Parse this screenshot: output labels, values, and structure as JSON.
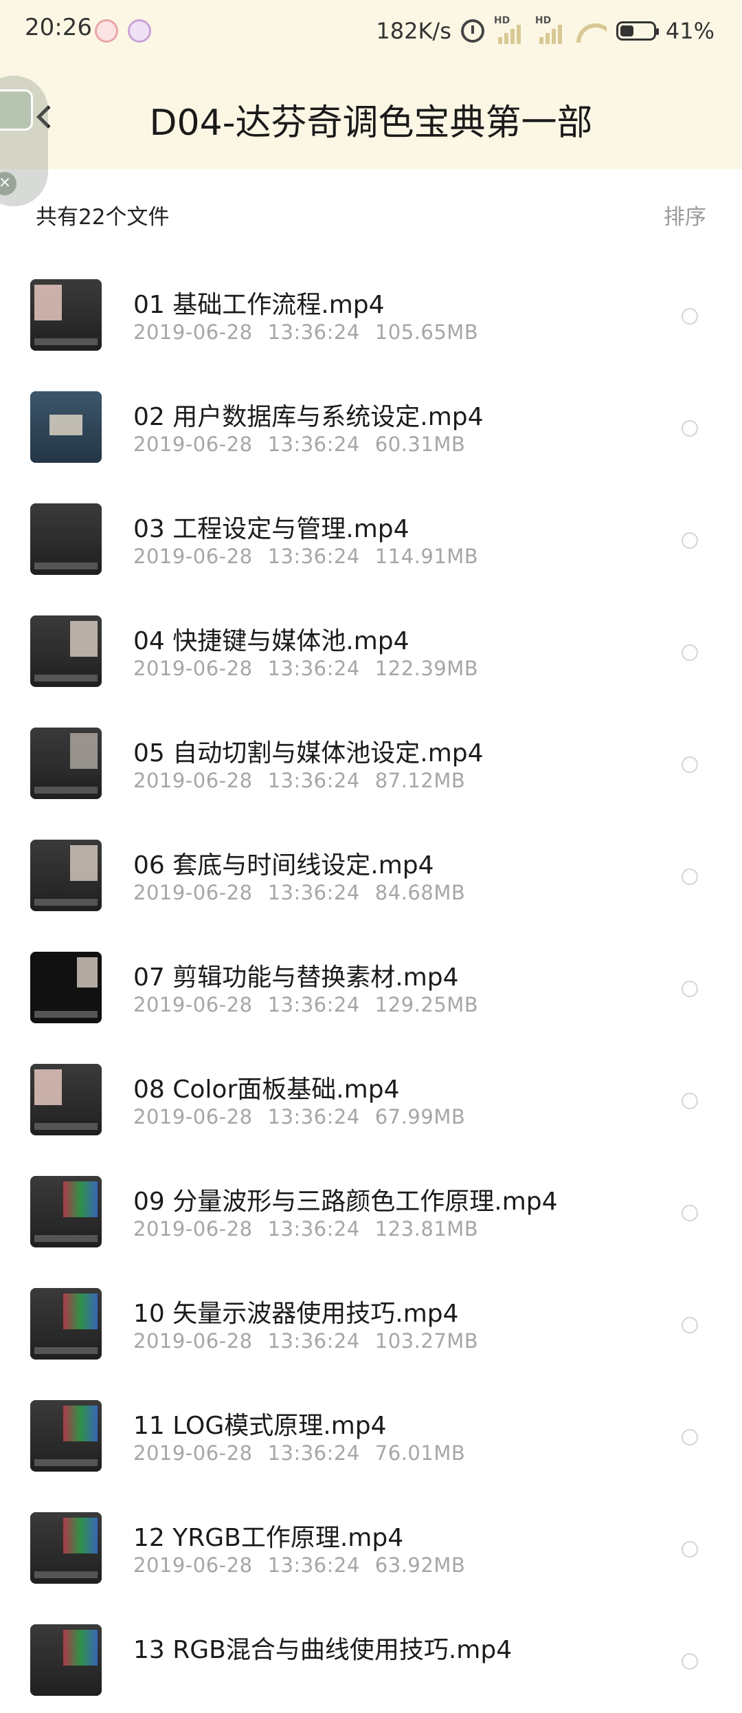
{
  "status_bar": {
    "time": "20:26",
    "net_speed": "182K/s",
    "signal1_label": "HD",
    "signal2_label": "HD",
    "battery": "41%"
  },
  "header": {
    "title": "D04-达芬奇调色宝典第一部"
  },
  "summary": {
    "count_text": "共有22个文件",
    "sort_label": "排序"
  },
  "files": [
    {
      "name": "01 基础工作流程.mp4",
      "date": "2019-06-28",
      "time": "13:36:24",
      "size": "105.65MB"
    },
    {
      "name": "02 用户数据库与系统设定.mp4",
      "date": "2019-06-28",
      "time": "13:36:24",
      "size": "60.31MB"
    },
    {
      "name": "03 工程设定与管理.mp4",
      "date": "2019-06-28",
      "time": "13:36:24",
      "size": "114.91MB"
    },
    {
      "name": "04 快捷键与媒体池.mp4",
      "date": "2019-06-28",
      "time": "13:36:24",
      "size": "122.39MB"
    },
    {
      "name": "05 自动切割与媒体池设定.mp4",
      "date": "2019-06-28",
      "time": "13:36:24",
      "size": "87.12MB"
    },
    {
      "name": "06 套底与时间线设定.mp4",
      "date": "2019-06-28",
      "time": "13:36:24",
      "size": "84.68MB"
    },
    {
      "name": "07 剪辑功能与替换素材.mp4",
      "date": "2019-06-28",
      "time": "13:36:24",
      "size": "129.25MB"
    },
    {
      "name": "08 Color面板基础.mp4",
      "date": "2019-06-28",
      "time": "13:36:24",
      "size": "67.99MB"
    },
    {
      "name": "09 分量波形与三路颜色工作原理.mp4",
      "date": "2019-06-28",
      "time": "13:36:24",
      "size": "123.81MB"
    },
    {
      "name": "10 矢量示波器使用技巧.mp4",
      "date": "2019-06-28",
      "time": "13:36:24",
      "size": "103.27MB"
    },
    {
      "name": "11 LOG模式原理.mp4",
      "date": "2019-06-28",
      "time": "13:36:24",
      "size": "76.01MB"
    },
    {
      "name": "12 YRGB工作原理.mp4",
      "date": "2019-06-28",
      "time": "13:36:24",
      "size": "63.92MB"
    },
    {
      "name": "13 RGB混合与曲线使用技巧.mp4",
      "date": "",
      "time": "",
      "size": ""
    }
  ]
}
